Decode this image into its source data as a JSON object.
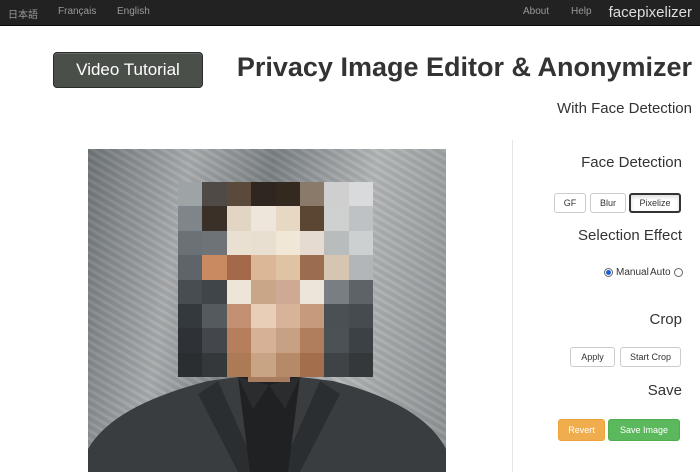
{
  "navbar": {
    "brand": "facepixelizer",
    "links": [
      "Help",
      "About"
    ],
    "languages": [
      "English",
      "Français",
      "日本語"
    ]
  },
  "header": {
    "title": "Privacy Image Editor & Anonymizer",
    "subtitle": "With Face Detection",
    "video_button": "Video Tutorial"
  },
  "panel": {
    "face_detection": {
      "heading": "Face Detection",
      "buttons": [
        "Pixelize",
        "Blur",
        "GF"
      ],
      "active": "Pixelize"
    },
    "selection_effect": {
      "heading": "Selection Effect",
      "options": [
        "Manual",
        "Auto"
      ],
      "selected": "Manual"
    },
    "crop": {
      "heading": "Crop",
      "buttons": [
        "Start Crop",
        "Apply"
      ]
    },
    "save": {
      "heading": "Save",
      "save_button": "Save Image",
      "revert_button": "Revert"
    }
  },
  "colors": {
    "navbar_bg": "#222222",
    "success": "#5cb85c",
    "warning": "#f0ad4e",
    "radio_accent": "#1a5fd0"
  },
  "pixel_colors": [
    [
      "#9ea3a5",
      "#4f4a45",
      "#5b4a3c",
      "#2f271f",
      "#34291f",
      "#8a7a6a",
      "#cfcfcf",
      "#d8dadb"
    ],
    [
      "#7e868c",
      "#3b3028",
      "#e2d5c4",
      "#eee6da",
      "#e7d8c4",
      "#5a4633",
      "#cfd1d1",
      "#bfc2c4"
    ],
    [
      "#6a7177",
      "#6e7378",
      "#e9e0d2",
      "#e8dfd0",
      "#f0e7d7",
      "#e5dbd0",
      "#b9bcbc",
      "#cdd0d0"
    ],
    [
      "#5e6469",
      "#c98a5f",
      "#a3694a",
      "#dcb797",
      "#e0c3a2",
      "#9b6d4e",
      "#d6c5b0",
      "#b2b6b8"
    ],
    [
      "#474d52",
      "#3f4549",
      "#ede5d8",
      "#c9a688",
      "#d0a994",
      "#ede5da",
      "#787e83",
      "#5e6368"
    ],
    [
      "#34393d",
      "#555a5e",
      "#c49074",
      "#e8cdb7",
      "#d7b39a",
      "#c69a7c",
      "#4b5054",
      "#464b4f"
    ],
    [
      "#2e3236",
      "#43474b",
      "#b77e5e",
      "#d6b196",
      "#c8a083",
      "#b17e5d",
      "#4c5155",
      "#3c4145"
    ],
    [
      "#2a2e31",
      "#34383b",
      "#ad7a56",
      "#c8a384",
      "#b68a68",
      "#a36e4b",
      "#3f4346",
      "#34383b"
    ]
  ]
}
